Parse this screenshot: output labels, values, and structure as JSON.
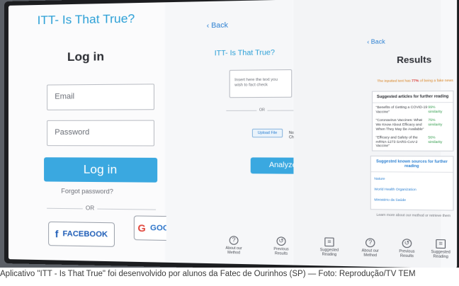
{
  "login": {
    "app_title": "ITT- Is That True?",
    "heading": "Log in",
    "email_placeholder": "Email",
    "password_placeholder": "Password",
    "login_button": "Log in",
    "forgot_password": "Forgot password?",
    "or": "OR",
    "facebook": "FACEBOOK",
    "google": "GOOGLE"
  },
  "check": {
    "back": "Back",
    "app_title": "ITT- Is That True?",
    "textarea_placeholder": "Insert here the text you wish to fact check",
    "or": "OR",
    "upload_button": "Upload File",
    "file_status": "No file Chosen",
    "analyze_button": "Analyze"
  },
  "results": {
    "back": "Back",
    "heading": "Results",
    "verdict_prefix": "The inputted text has",
    "verdict_percent": "77%",
    "verdict_suffix": "of being a fake news",
    "articles_heading": "Suggested articles for further reading",
    "articles": [
      {
        "title": "\"Benefits of Getting a COVID-19 Vaccine\"",
        "score": "99% similarity"
      },
      {
        "title": "\"Coronavirus Vaccines: What We Know About Efficacy and When They May Be Available\"",
        "score": "75% similarity"
      },
      {
        "title": "\"Efficacy and Safety of the mRNA-1273 SARS-CoV-2 Vaccine\"",
        "score": "56% similarity"
      }
    ],
    "sources_heading": "Suggested known sources for further reading",
    "sources": [
      "Nature",
      "World Health Organization",
      "Ministério da Saúde"
    ],
    "learn_more": "Learn more about our method or retrieve them"
  },
  "bottom_nav": {
    "items": [
      {
        "label": "About our Method",
        "icon": "question-icon"
      },
      {
        "label": "Previous Results",
        "icon": "history-icon"
      },
      {
        "label": "Suggested Reading",
        "icon": "document-icon"
      },
      {
        "label": "About our Method",
        "icon": "question-icon"
      },
      {
        "label": "Previous Results",
        "icon": "history-icon"
      },
      {
        "label": "Suggested Reading",
        "icon": "document-icon"
      }
    ]
  },
  "caption": "Aplicativo \"ITT - Is That True\" foi desenvolvido por alunos da Fatec de Ourinhos (SP) — Foto: Reprodução/TV TEM"
}
